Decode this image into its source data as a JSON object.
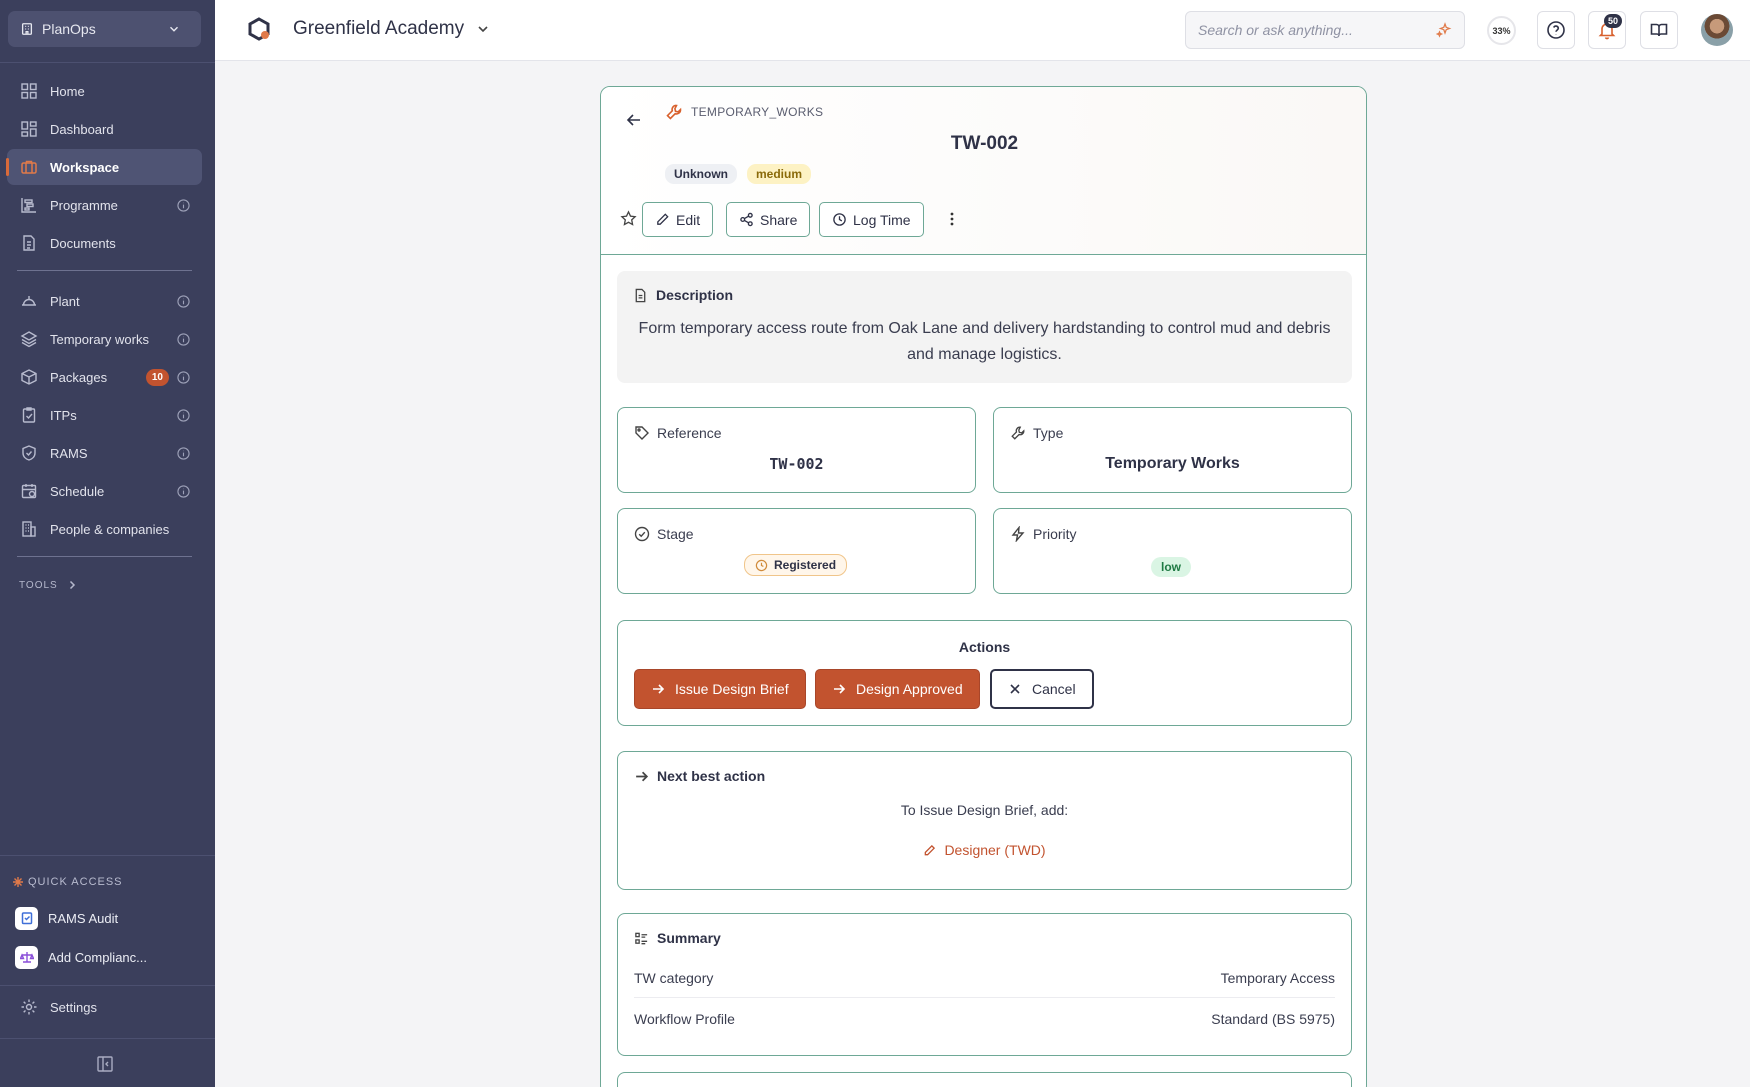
{
  "sidebar": {
    "org": "PlanOps",
    "nav": [
      {
        "label": "Home",
        "icon": "grid-icon"
      },
      {
        "label": "Dashboard",
        "icon": "dashboard-icon"
      },
      {
        "label": "Workspace",
        "icon": "briefcase-icon",
        "active": true
      },
      {
        "label": "Programme",
        "icon": "chart-icon",
        "info": true
      },
      {
        "label": "Documents",
        "icon": "document-icon"
      }
    ],
    "nav2": [
      {
        "label": "Plant",
        "icon": "helmet-icon",
        "info": true
      },
      {
        "label": "Temporary works",
        "icon": "layers-icon",
        "info": true
      },
      {
        "label": "Packages",
        "icon": "package-icon",
        "badge": "10",
        "info": true
      },
      {
        "label": "ITPs",
        "icon": "clipboard-check-icon",
        "info": true
      },
      {
        "label": "RAMS",
        "icon": "shield-check-icon",
        "info": true
      },
      {
        "label": "Schedule",
        "icon": "calendar-icon",
        "info": true
      },
      {
        "label": "People & companies",
        "icon": "building-icon"
      }
    ],
    "tools_label": "TOOLS",
    "quick_access_label": "QUICK ACCESS",
    "quick_items": [
      "RAMS Audit",
      "Add Complianc..."
    ],
    "settings_label": "Settings"
  },
  "topbar": {
    "project": "Greenfield Academy",
    "search_placeholder": "Search or ask anything...",
    "progress": "33%",
    "notifications": "50"
  },
  "item": {
    "kind": "TEMPORARY_WORKS",
    "title": "TW-002",
    "status_chip": "Unknown",
    "priority_chip": "medium",
    "buttons": {
      "edit": "Edit",
      "share": "Share",
      "log_time": "Log Time"
    },
    "description_title": "Description",
    "description": "Form temporary access route from Oak Lane and delivery hardstanding to control mud and debris and manage logistics.",
    "fields": {
      "reference_label": "Reference",
      "reference": "TW-002",
      "type_label": "Type",
      "type": "Temporary Works",
      "stage_label": "Stage",
      "stage": "Registered",
      "priority_label": "Priority",
      "priority": "low"
    },
    "actions": {
      "title": "Actions",
      "issue": "Issue Design Brief",
      "approved": "Design Approved",
      "cancel": "Cancel"
    },
    "next_best": {
      "title": "Next best action",
      "sub": "To Issue Design Brief, add:",
      "link": "Designer (TWD)"
    },
    "summary": {
      "title": "Summary",
      "rows": [
        {
          "label": "TW category",
          "value": "Temporary Access"
        },
        {
          "label": "Workflow Profile",
          "value": "Standard (BS 5975)"
        }
      ]
    }
  },
  "colors": {
    "accent": "#c2532f",
    "sidebar": "#3b3f5c",
    "border": "#6ea896"
  }
}
